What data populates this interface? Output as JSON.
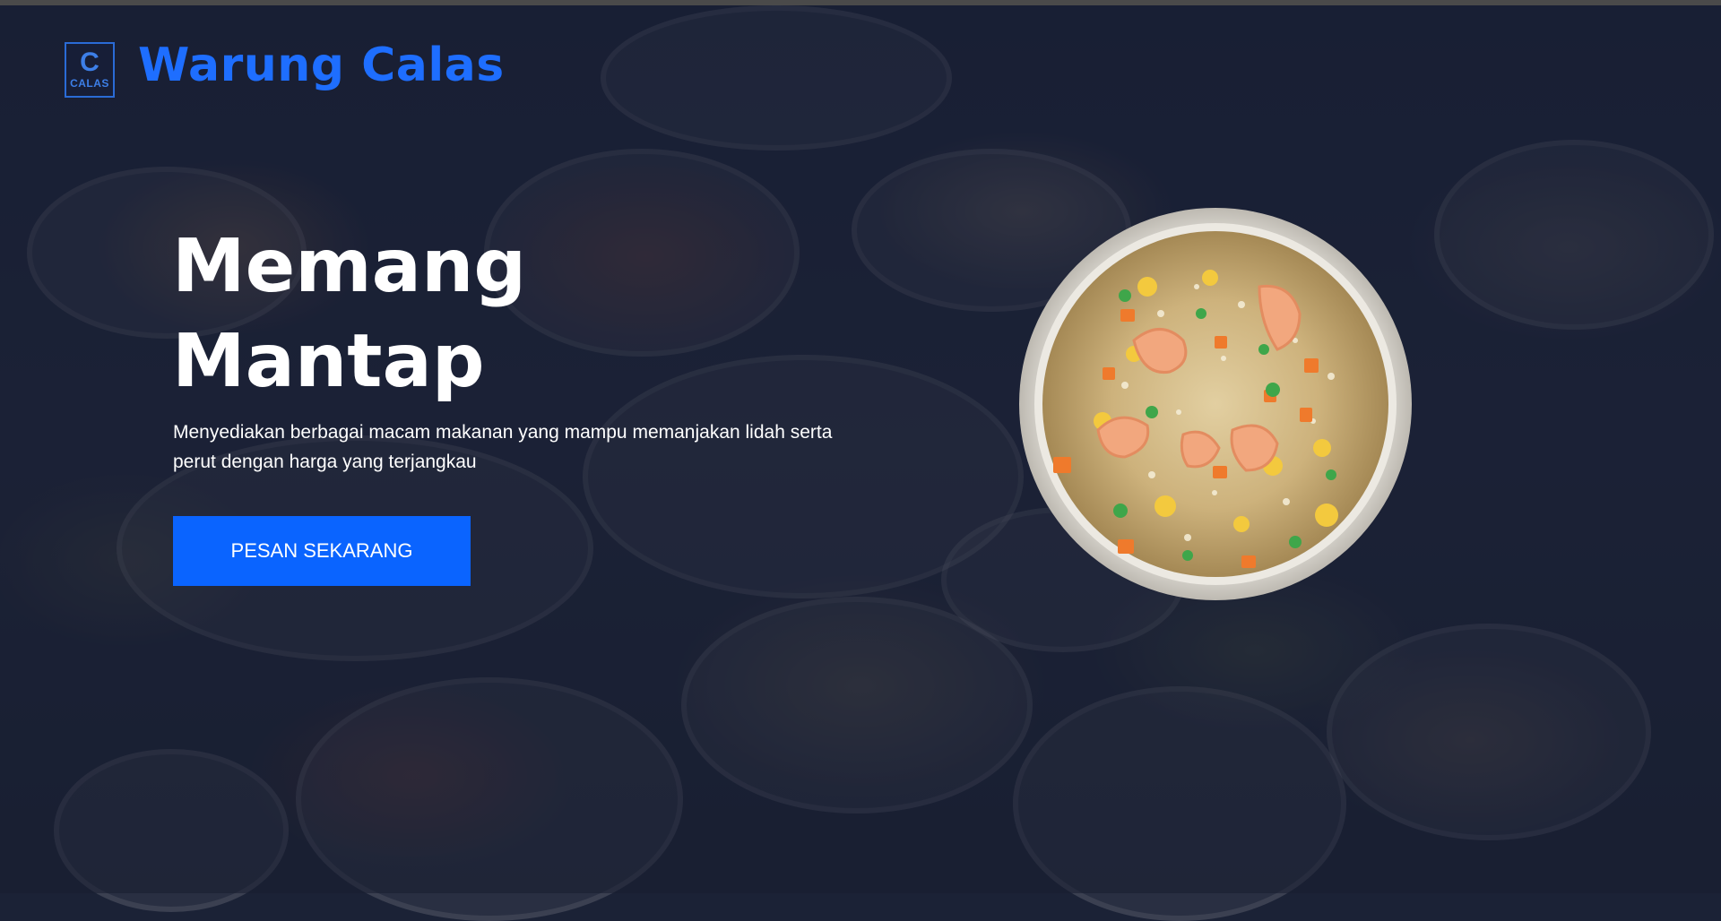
{
  "brand": {
    "logo_glyph": "C",
    "logo_text": "CALAS",
    "name": "Warung Calas",
    "color": "#1e6eff"
  },
  "hero": {
    "title_line1": "Memang",
    "title_line2": "Mantap",
    "subtitle": "Menyediakan berbagai macam makanan yang mampu memanjakan lidah serta perut dengan harga yang terjangkau",
    "cta_label": "PESAN SEKARANG",
    "cta_color": "#0a64ff",
    "dish_image": "fried-rice-bowl-image",
    "background_image": "food-table-background"
  }
}
